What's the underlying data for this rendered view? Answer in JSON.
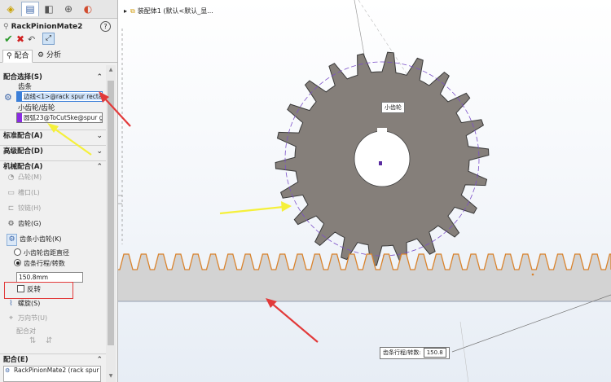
{
  "tabs": [
    "feature-manager",
    "property-manager",
    "configuration-manager",
    "dim-xpert",
    "display-manager"
  ],
  "title": "RackPinionMate2",
  "subtabs": {
    "mates": "配合",
    "analysis": "分析"
  },
  "sections": {
    "mate_selections": "配合选择(S)",
    "rack_label": "齿条",
    "rack_value": "边线<1>@rack spur rectangu",
    "pinion_label": "小齿轮/齿轮",
    "pinion_value": "圆弧23@ToCutSke@spur ge",
    "standard": "标准配合(A)",
    "advanced": "高级配合(D)",
    "mechanical": "机械配合(A)"
  },
  "mechanical_items": [
    {
      "label": "凸轮(M)",
      "enabled": false
    },
    {
      "label": "槽口(L)",
      "enabled": false
    },
    {
      "label": "铰链(H)",
      "enabled": false
    },
    {
      "label": "齿轮(G)",
      "enabled": true
    },
    {
      "label": "齿条小齿轮(K)",
      "enabled": true
    }
  ],
  "radio_options": {
    "pitch_diameter": "小齿轮齿距直径",
    "rack_travel": "齿条行程/转数"
  },
  "distance_value": "150.8mm",
  "reverse_label": "反转",
  "extra_items": {
    "screw": "螺旋(S)",
    "universal": "万向节(U)",
    "mate_align": "配合对"
  },
  "mates_section": "配合(E)",
  "mates_list_item": "RackPinionMate2 (rack spur",
  "tree_path": "装配体1 (默认<默认_显...",
  "gear_label": "小齿轮",
  "bottom_note_label": "齿条行程/转数:",
  "bottom_note_value": "150.8",
  "colors": {
    "gear_fill": "#857f7a",
    "rack_fill": "#d3d3d3",
    "rack_teeth": "#d9822b",
    "red_arrow": "#e23a3a",
    "yellow_arrow": "#f5f03a",
    "pitch_circle": "#7b4fc8"
  }
}
